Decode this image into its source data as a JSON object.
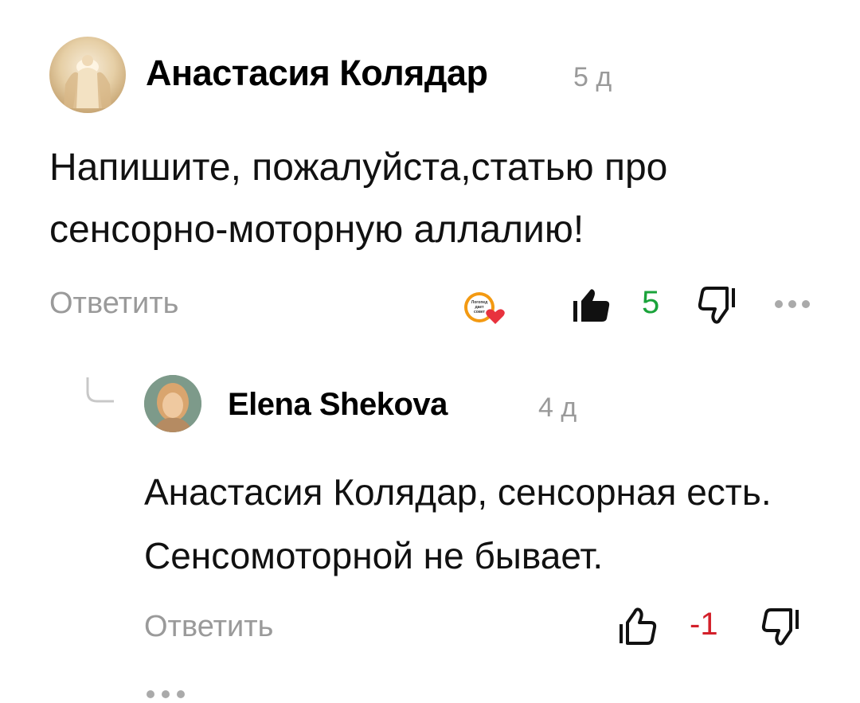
{
  "comment": {
    "author": "Анастасия Колядар",
    "time": "5 д",
    "text": "Напишите, пожалуйста,статью про сенсорно-моторную аллалию!",
    "reply_label": "Ответить",
    "reaction_badge_text": "Логопед дает совет",
    "likes": "5",
    "like_color": "#1aa33a",
    "icons": [
      "avatar",
      "reaction-icon",
      "like-icon",
      "dislike-icon",
      "more-icon"
    ]
  },
  "reply": {
    "author": "Elena Shekova",
    "time": "4 д",
    "text": "Анастасия Колядар, сенсорная есть. Сенсомоторной не бывает.",
    "reply_label": "Ответить",
    "likes": "-1",
    "like_color": "#d3202a",
    "icons": [
      "thread-line-icon",
      "avatar",
      "like-icon",
      "dislike-icon",
      "more-icon"
    ]
  }
}
